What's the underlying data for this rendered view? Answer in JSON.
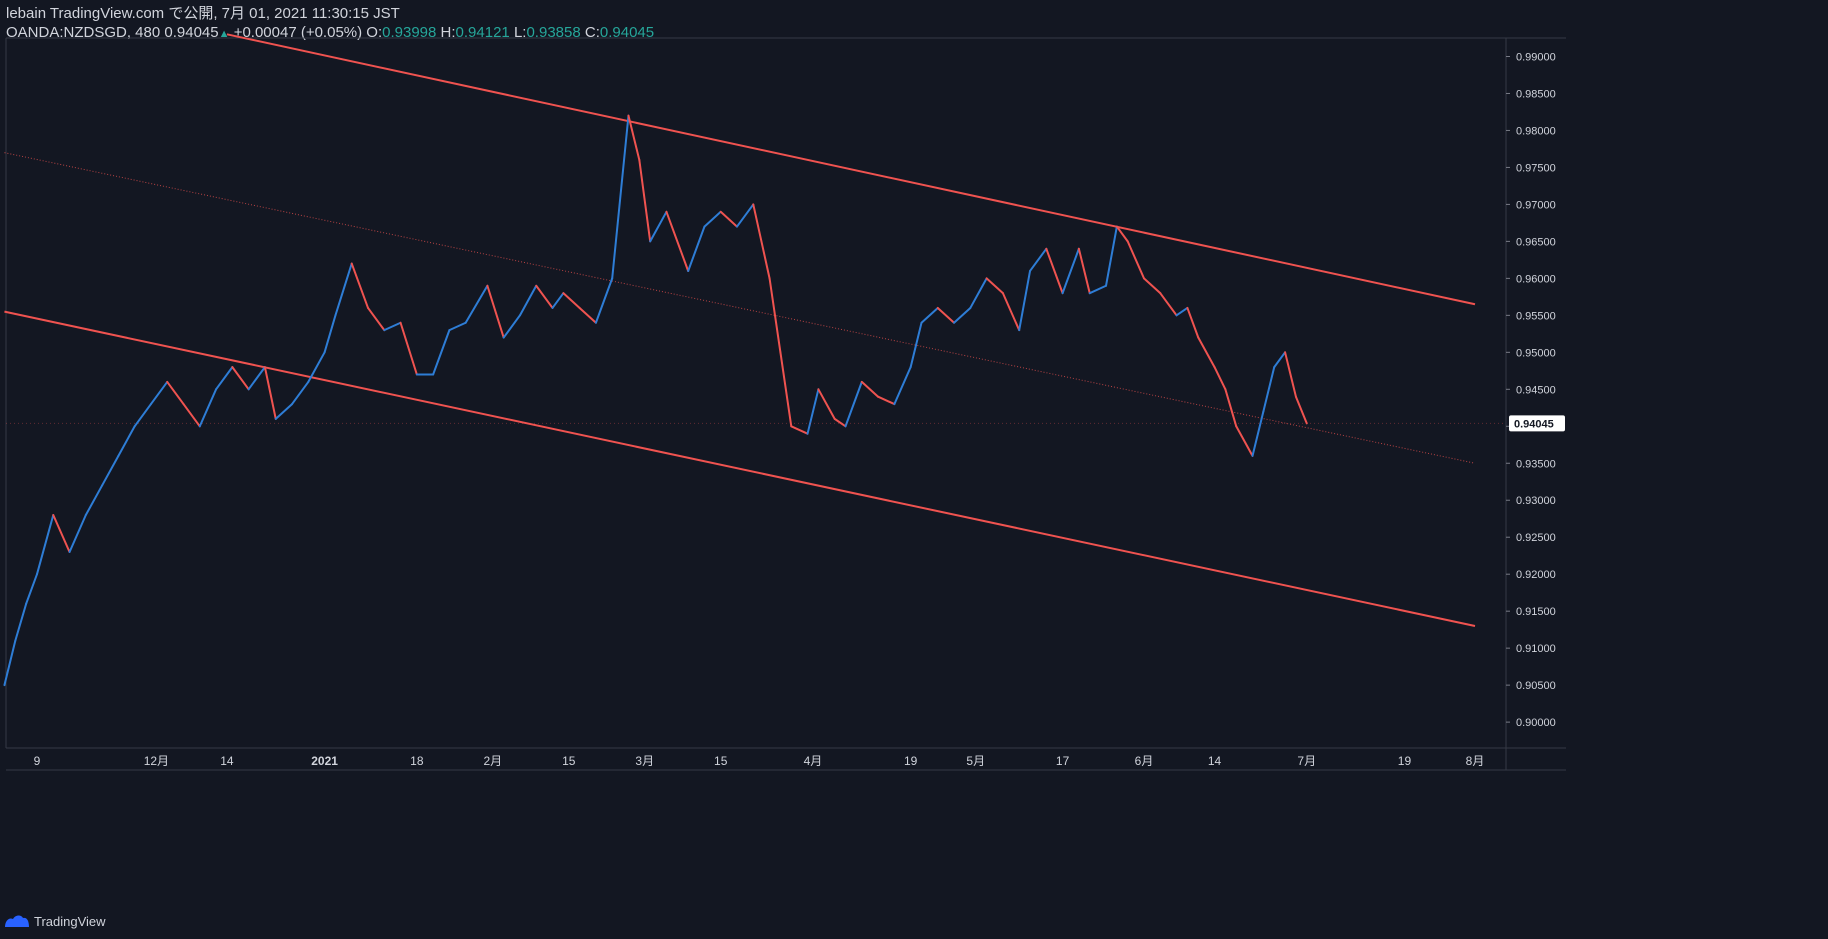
{
  "header": {
    "line1": "lebain TradingView.com で公開, 7月 01, 2021 11:30:15 JST",
    "symbol": "OANDA:NZDSGD, 480",
    "last": "0.94045",
    "change_arrow": "▲",
    "change": "+0.00047 (+0.05%)",
    "o_label": "O:",
    "o_value": "0.93998",
    "h_label": "H:",
    "h_value": "0.94121",
    "l_label": "L:",
    "l_value": "0.93858",
    "c_label": "C:",
    "c_value": "0.94045"
  },
  "footer": {
    "brand": "TradingView"
  },
  "colors": {
    "background": "#131722",
    "bull": "#2e7dd6",
    "bear": "#ef5350",
    "channel": "#f05350",
    "axis_text": "#d1d4dc",
    "price_tag_bg": "#ffffff",
    "price_tag_text": "#131722"
  },
  "chart_data": {
    "type": "line",
    "title": "",
    "ylim": [
      0.8965,
      0.9925
    ],
    "y_ticks": [
      "0.90000",
      "0.90500",
      "0.91000",
      "0.91500",
      "0.92000",
      "0.92500",
      "0.93000",
      "0.93500",
      "0.94000",
      "0.94500",
      "0.95000",
      "0.95500",
      "0.96000",
      "0.96500",
      "0.97000",
      "0.97500",
      "0.98000",
      "0.98500",
      "0.99000"
    ],
    "x_ticks": [
      "9",
      "12月",
      "14",
      "2021",
      "18",
      "2月",
      "15",
      "3月",
      "15",
      "4月",
      "19",
      "5月",
      "17",
      "6月",
      "14",
      "7月",
      "19",
      "8月"
    ],
    "x_tick_dates": [
      "2020-11-09",
      "2020-12-01",
      "2020-12-14",
      "2021-01-01",
      "2021-01-18",
      "2021-02-01",
      "2021-02-15",
      "2021-03-01",
      "2021-03-15",
      "2021-04-01",
      "2021-04-19",
      "2021-05-01",
      "2021-05-17",
      "2021-06-01",
      "2021-06-14",
      "2021-07-01",
      "2021-07-19",
      "2021-08-01"
    ],
    "current_price_label": "0.94045",
    "series": [
      {
        "values": [
          [
            "2020-11-03",
            0.905
          ],
          [
            "2020-11-05",
            0.911
          ],
          [
            "2020-11-07",
            0.916
          ],
          [
            "2020-11-09",
            0.92
          ],
          [
            "2020-11-12",
            0.928
          ],
          [
            "2020-11-15",
            0.923
          ],
          [
            "2020-11-18",
            0.928
          ],
          [
            "2020-11-21",
            0.932
          ],
          [
            "2020-11-24",
            0.936
          ],
          [
            "2020-11-27",
            0.94
          ],
          [
            "2020-11-30",
            0.943
          ],
          [
            "2020-12-03",
            0.946
          ],
          [
            "2020-12-06",
            0.943
          ],
          [
            "2020-12-09",
            0.94
          ],
          [
            "2020-12-12",
            0.945
          ],
          [
            "2020-12-15",
            0.948
          ],
          [
            "2020-12-18",
            0.945
          ],
          [
            "2020-12-21",
            0.948
          ],
          [
            "2020-12-23",
            0.941
          ],
          [
            "2020-12-26",
            0.943
          ],
          [
            "2020-12-29",
            0.946
          ],
          [
            "2021-01-01",
            0.95
          ],
          [
            "2021-01-03",
            0.955
          ],
          [
            "2021-01-06",
            0.962
          ],
          [
            "2021-01-09",
            0.956
          ],
          [
            "2021-01-12",
            0.953
          ],
          [
            "2021-01-15",
            0.954
          ],
          [
            "2021-01-18",
            0.947
          ],
          [
            "2021-01-21",
            0.947
          ],
          [
            "2021-01-24",
            0.953
          ],
          [
            "2021-01-27",
            0.954
          ],
          [
            "2021-01-31",
            0.959
          ],
          [
            "2021-02-03",
            0.952
          ],
          [
            "2021-02-06",
            0.955
          ],
          [
            "2021-02-09",
            0.959
          ],
          [
            "2021-02-12",
            0.956
          ],
          [
            "2021-02-14",
            0.958
          ],
          [
            "2021-02-17",
            0.956
          ],
          [
            "2021-02-20",
            0.954
          ],
          [
            "2021-02-23",
            0.96
          ],
          [
            "2021-02-26",
            0.982
          ],
          [
            "2021-02-28",
            0.976
          ],
          [
            "2021-03-02",
            0.965
          ],
          [
            "2021-03-05",
            0.969
          ],
          [
            "2021-03-09",
            0.961
          ],
          [
            "2021-03-12",
            0.967
          ],
          [
            "2021-03-15",
            0.969
          ],
          [
            "2021-03-18",
            0.967
          ],
          [
            "2021-03-21",
            0.97
          ],
          [
            "2021-03-24",
            0.96
          ],
          [
            "2021-03-26",
            0.95
          ],
          [
            "2021-03-28",
            0.94
          ],
          [
            "2021-03-31",
            0.939
          ],
          [
            "2021-04-02",
            0.945
          ],
          [
            "2021-04-05",
            0.941
          ],
          [
            "2021-04-07",
            0.94
          ],
          [
            "2021-04-10",
            0.946
          ],
          [
            "2021-04-13",
            0.944
          ],
          [
            "2021-04-16",
            0.943
          ],
          [
            "2021-04-19",
            0.948
          ],
          [
            "2021-04-21",
            0.954
          ],
          [
            "2021-04-24",
            0.956
          ],
          [
            "2021-04-27",
            0.954
          ],
          [
            "2021-04-30",
            0.956
          ],
          [
            "2021-05-03",
            0.96
          ],
          [
            "2021-05-06",
            0.958
          ],
          [
            "2021-05-09",
            0.953
          ],
          [
            "2021-05-11",
            0.961
          ],
          [
            "2021-05-14",
            0.964
          ],
          [
            "2021-05-17",
            0.958
          ],
          [
            "2021-05-20",
            0.964
          ],
          [
            "2021-05-22",
            0.958
          ],
          [
            "2021-05-25",
            0.959
          ],
          [
            "2021-05-27",
            0.967
          ],
          [
            "2021-05-29",
            0.965
          ],
          [
            "2021-06-01",
            0.96
          ],
          [
            "2021-06-04",
            0.958
          ],
          [
            "2021-06-07",
            0.955
          ],
          [
            "2021-06-09",
            0.956
          ],
          [
            "2021-06-11",
            0.952
          ],
          [
            "2021-06-14",
            0.948
          ],
          [
            "2021-06-16",
            0.945
          ],
          [
            "2021-06-18",
            0.94
          ],
          [
            "2021-06-21",
            0.936
          ],
          [
            "2021-06-23",
            0.942
          ],
          [
            "2021-06-25",
            0.948
          ],
          [
            "2021-06-27",
            0.95
          ],
          [
            "2021-06-29",
            0.944
          ],
          [
            "2021-07-01",
            0.9404
          ]
        ]
      }
    ],
    "channel_lines": [
      {
        "name": "upper",
        "from": [
          "2020-12-14",
          0.993
        ],
        "to": [
          "2021-08-01",
          0.9565
        ]
      },
      {
        "name": "middle",
        "style": "dotted",
        "from": [
          "2020-11-03",
          0.977
        ],
        "to": [
          "2021-08-01",
          0.935
        ]
      },
      {
        "name": "lower",
        "from": [
          "2020-11-03",
          0.9555
        ],
        "to": [
          "2021-08-01",
          0.913
        ]
      }
    ]
  }
}
